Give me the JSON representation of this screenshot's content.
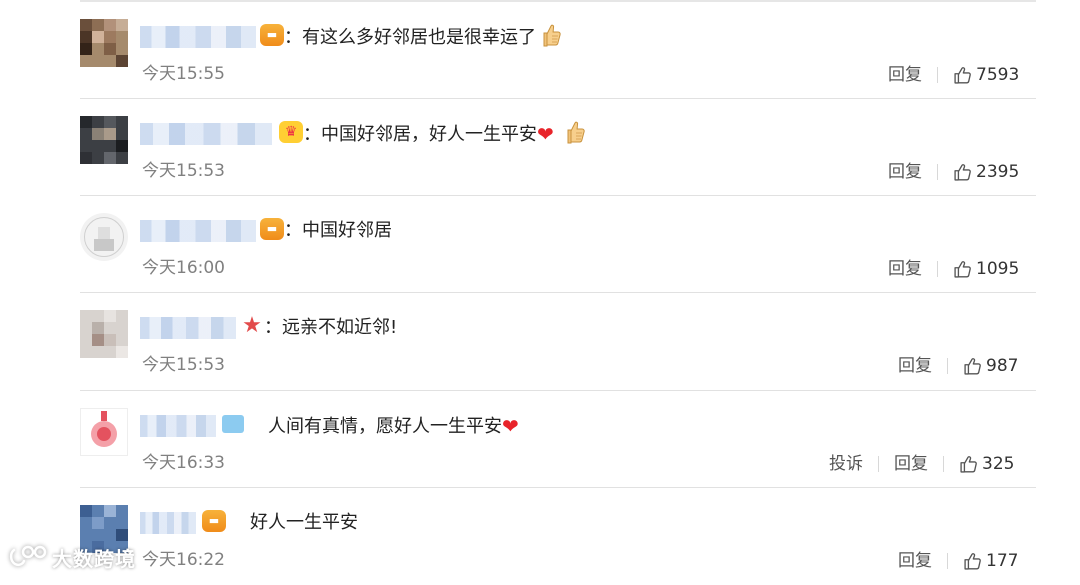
{
  "comments": [
    {
      "text": "：有这么多好邻居也是很幸运了",
      "time": "今天15:55",
      "reply": "回复",
      "likes": "7593",
      "badge": "orange",
      "emoji": "thumbs"
    },
    {
      "text": "：中国好邻居，好人一生平安",
      "time": "今天15:53",
      "reply": "回复",
      "likes": "2395",
      "badge": "crown",
      "emoji": "heart+thumbs"
    },
    {
      "text": "：中国好邻居",
      "time": "今天16:00",
      "reply": "回复",
      "likes": "1095",
      "badge": "orange",
      "emoji": ""
    },
    {
      "text": "：远亲不如近邻!",
      "time": "今天15:53",
      "reply": "回复",
      "likes": "987",
      "badge": "star",
      "emoji": ""
    },
    {
      "text": "人间有真情，愿好人一生平安",
      "time": "今天16:33",
      "complain": "投诉",
      "reply": "回复",
      "likes": "325",
      "badge": "shirt",
      "emoji": "heart"
    },
    {
      "text": "好人一生平安",
      "time": "今天16:22",
      "reply": "回复",
      "likes": "177",
      "badge": "orange",
      "emoji": ""
    }
  ],
  "emoji": {
    "heart": "❤"
  },
  "watermark": {
    "text": "大数跨境"
  },
  "colors": {
    "heart": "#e8242a",
    "time": "#808080",
    "divider": "#e1e1e1",
    "badge_orange": "#f29a26"
  }
}
